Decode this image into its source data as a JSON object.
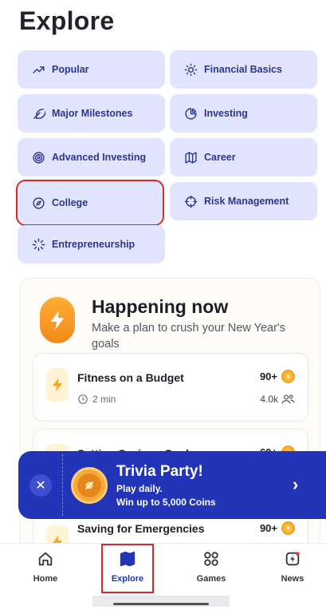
{
  "page": {
    "title": "Explore"
  },
  "categories": [
    {
      "label": "Popular",
      "icon": "trending-up-icon"
    },
    {
      "label": "Financial Basics",
      "icon": "sun-icon"
    },
    {
      "label": "Major Milestones",
      "icon": "feather-icon"
    },
    {
      "label": "Investing",
      "icon": "pie-chart-icon"
    },
    {
      "label": "Advanced Investing",
      "icon": "target-icon"
    },
    {
      "label": "Career",
      "icon": "map-icon"
    },
    {
      "label": "College",
      "icon": "compass-icon",
      "selected": true
    },
    {
      "label": "Risk Management",
      "icon": "crosshair-icon"
    },
    {
      "label": "Entrepreneurship",
      "icon": "loader-icon"
    }
  ],
  "happening": {
    "title": "Happening now",
    "subtitle": "Make a plan to crush your New Year's goals",
    "lessons": [
      {
        "title": "Fitness on a Budget",
        "coins": "90+",
        "time": "2 min",
        "learners": "4.0k"
      },
      {
        "title": "Setting Savings Goals",
        "coins": "60+"
      },
      {
        "title": "Saving for Emergencies",
        "coins": "90+"
      }
    ]
  },
  "trivia": {
    "title": "Trivia Party!",
    "line1": "Play daily.",
    "line2": "Win up to 5,000 Coins"
  },
  "nav": [
    {
      "label": "Home",
      "icon": "home-icon"
    },
    {
      "label": "Explore",
      "icon": "map-icon",
      "active": true
    },
    {
      "label": "Games",
      "icon": "grid-icon"
    },
    {
      "label": "News",
      "icon": "news-icon"
    }
  ],
  "colors": {
    "accent": "#2234b8",
    "chip": "#e1e5ff",
    "highlight": "#d42a2a",
    "coin": "#f7b63a"
  }
}
